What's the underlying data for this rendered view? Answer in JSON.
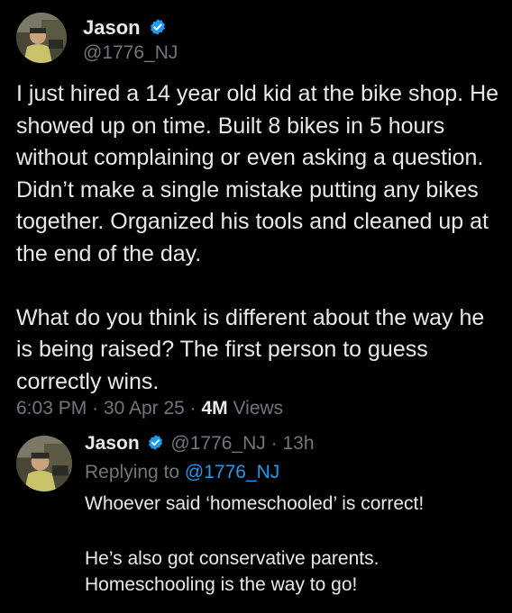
{
  "tweet": {
    "author_name": "Jason",
    "author_handle": "@1776_NJ",
    "text": "I just hired a 14 year old kid at the bike shop. He showed up on time. Built 8 bikes in 5 hours without complaining or even asking a question. Didn’t make a single mistake putting any bikes together. Organized his tools and cleaned up at the end of the day.\n\nWhat do you think is different about the way he is being raised? The first person to guess correctly wins.",
    "timestamp": "6:03 PM",
    "date": "30 Apr 25",
    "separator": "·",
    "views_count": "4M",
    "views_label": "Views"
  },
  "reply": {
    "author_name": "Jason",
    "author_handle": "@1776_NJ",
    "separator": "·",
    "time_ago": "13h",
    "replying_to_label": "Replying to",
    "replying_to_handle": "@1776_NJ",
    "text_1": "Whoever said ‘homeschooled’ is correct!",
    "text_2": "He’s also got conservative parents.\nHomeschooling is the way to go!"
  },
  "colors": {
    "background": "#000000",
    "text": "#e7e9ea",
    "secondary": "#71767b",
    "accent": "#1d9bf0"
  },
  "icons": [
    "verified-badge-icon",
    "avatar"
  ]
}
